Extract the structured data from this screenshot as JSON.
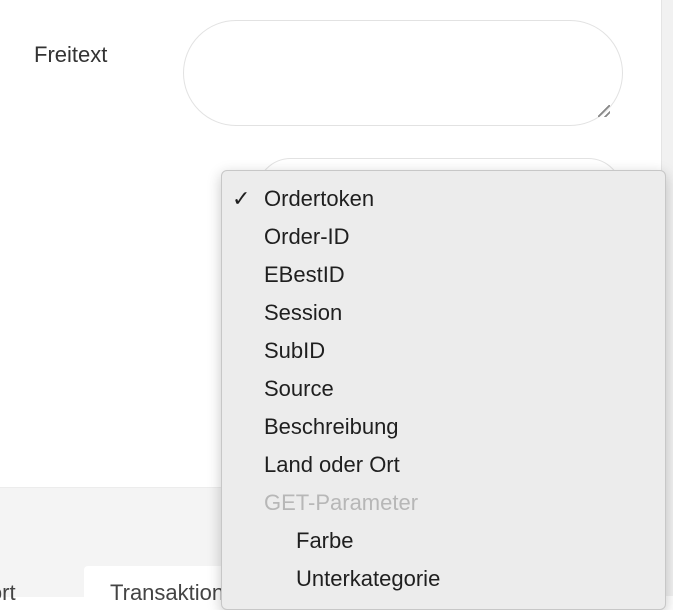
{
  "form": {
    "freitext_label": "Freitext",
    "freitext_value": ""
  },
  "dropdown": {
    "selected": "Ordertoken",
    "check_glyph": "✓",
    "options": [
      {
        "label": "Ordertoken",
        "selected": true
      },
      {
        "label": "Order-ID"
      },
      {
        "label": "EBestID"
      },
      {
        "label": "Session"
      },
      {
        "label": "SubID"
      },
      {
        "label": "Source"
      },
      {
        "label": "Beschreibung"
      },
      {
        "label": "Land oder Ort"
      },
      {
        "label": "GET-Parameter",
        "group_header": true
      },
      {
        "label": "Farbe",
        "indented": true
      },
      {
        "label": "Unterkategorie",
        "indented": true
      }
    ]
  },
  "tabs": {
    "export_label": "Export",
    "transaktionen_label": "Transaktionen"
  }
}
